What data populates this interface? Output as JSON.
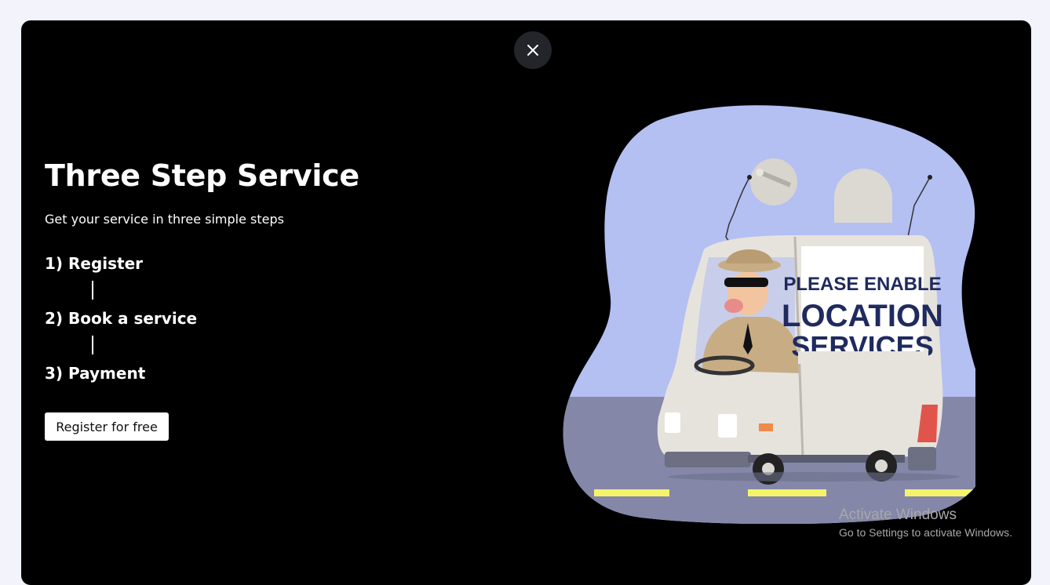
{
  "modal": {
    "close_icon": "close-icon",
    "title": "Three Step Service",
    "subtitle": "Get your service in three simple steps",
    "steps": [
      {
        "label": "1) Register"
      },
      {
        "label": "2) Book a service"
      },
      {
        "label": "3) Payment"
      }
    ],
    "register_button": "Register for free",
    "illustration": {
      "sign_line1": "PLEASE ENABLE",
      "sign_line2": "LOCATION",
      "sign_line3": "SERVICES"
    }
  },
  "watermark": {
    "title": "Activate Windows",
    "subtitle": "Go to Settings to activate Windows."
  },
  "colors": {
    "page_background": "#f2f3fb",
    "modal_background": "#000000",
    "close_button": "#23252a",
    "blob_sky": "#b4bff2",
    "road": "#8487a8",
    "road_markings": "#f5f36a"
  }
}
